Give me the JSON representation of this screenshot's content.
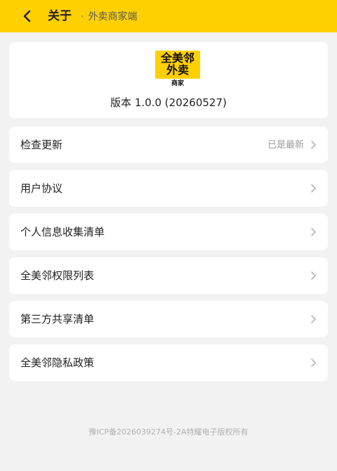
{
  "header": {
    "title": "关于",
    "subtitle": "外卖商家端"
  },
  "about": {
    "logo_line1": "全美邻",
    "logo_line2": "外卖",
    "logo_tag": "商家",
    "version": "版本 1.0.0 (20260527)"
  },
  "menu": [
    {
      "label": "检查更新",
      "value": "已是最新"
    },
    {
      "label": "用户协议"
    },
    {
      "label": "个人信息收集清单"
    },
    {
      "label": "全美邻权限列表"
    },
    {
      "label": "第三方共享清单"
    },
    {
      "label": "全美邻隐私政策"
    }
  ],
  "footer": {
    "text": "豫ICP备2026039274号-2A特耀电子版权所有"
  },
  "colors": {
    "accent": "#ffd000",
    "background": "#f2f2f2"
  }
}
